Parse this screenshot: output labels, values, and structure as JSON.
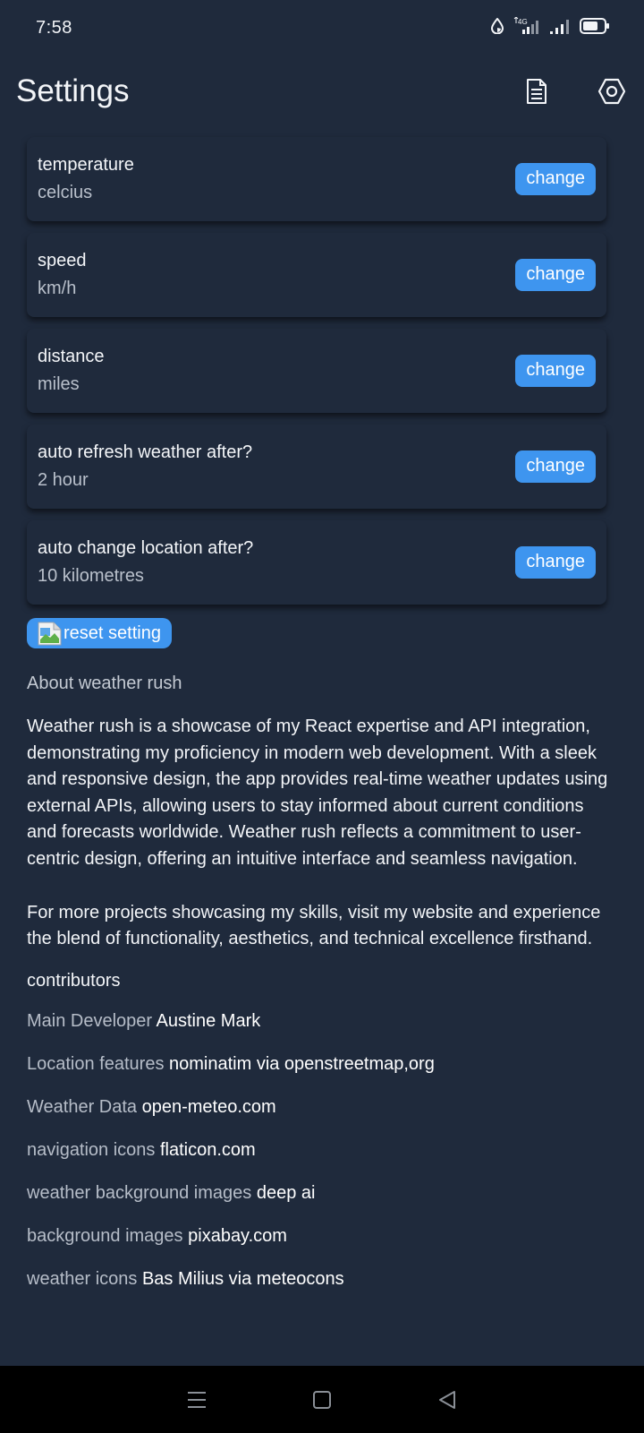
{
  "status_bar": {
    "time": "7:58",
    "icons": [
      "data-saver-icon",
      "4g-signal-icon",
      "signal-icon",
      "battery-icon"
    ],
    "network_label": "4G"
  },
  "header": {
    "title": "Settings",
    "actions": [
      "document-icon",
      "settings-hexagon-icon"
    ]
  },
  "settings": [
    {
      "label": "temperature",
      "value": "celcius",
      "button": "change"
    },
    {
      "label": "speed",
      "value": "km/h",
      "button": "change"
    },
    {
      "label": "distance",
      "value": "miles",
      "button": "change"
    },
    {
      "label": "auto refresh weather after?",
      "value": "2 hour",
      "button": "change"
    },
    {
      "label": "auto change location after?",
      "value": "10 kilometres",
      "button": "change"
    }
  ],
  "reset": {
    "label": "reset setting"
  },
  "about": {
    "title": "About weather rush",
    "paragraphs": [
      "Weather rush is a showcase of my React expertise and API integration, demonstrating my proficiency in modern web development. With a sleek and responsive design, the app provides real-time weather updates using external APIs, allowing users to stay informed about current conditions and forecasts worldwide. Weather rush reflects a commitment to user-centric design, offering an intuitive interface and seamless navigation.",
      "For more projects showcasing my skills, visit my website and experience the blend of functionality, aesthetics, and technical excellence firsthand."
    ]
  },
  "contributors": {
    "title": "contributors",
    "items": [
      {
        "role": "Main Developer",
        "name": "Austine Mark"
      },
      {
        "role": "Location features",
        "name": "nominatim via openstreetmap,org"
      },
      {
        "role": "Weather Data",
        "name": "open-meteo.com"
      },
      {
        "role": "navigation icons",
        "name": "flaticon.com"
      },
      {
        "role": "weather background images",
        "name": "deep ai"
      },
      {
        "role": "background images",
        "name": "pixabay.com"
      },
      {
        "role": "weather icons",
        "name": "Bas Milius via meteocons"
      }
    ]
  },
  "nav_bar": {
    "buttons": [
      "menu-icon",
      "home-square-icon",
      "back-triangle-icon"
    ]
  },
  "colors": {
    "background": "#1f2a3c",
    "accent": "#3e95ef",
    "nav_bar": "#000000"
  }
}
